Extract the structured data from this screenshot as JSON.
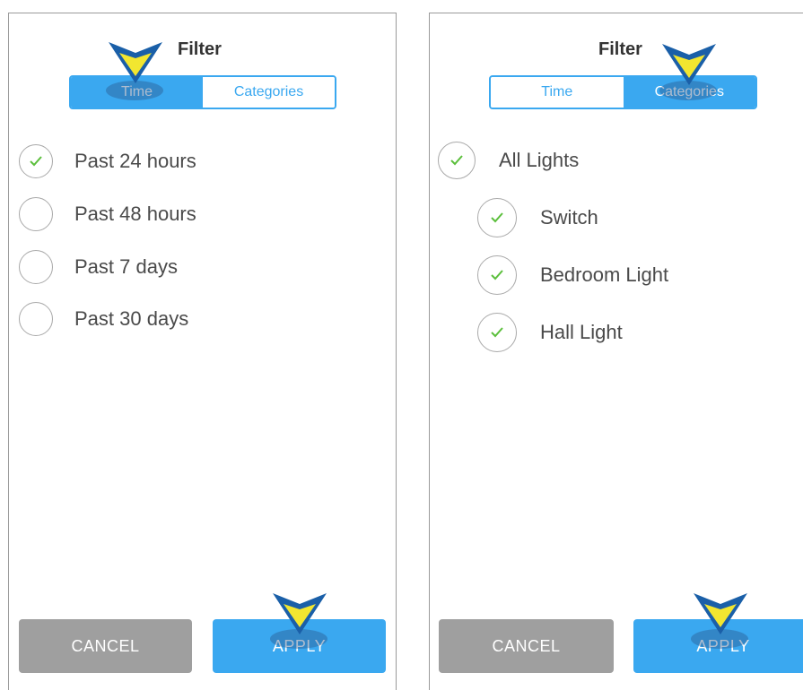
{
  "colors": {
    "accent": "#3aa8f0",
    "check": "#5bbf3c",
    "cancel": "#9f9f9f",
    "marker_fill": "#f2e630",
    "marker_edge": "#1a5fa8"
  },
  "left": {
    "title": "Filter",
    "tabs": [
      {
        "label": "Time",
        "active": true
      },
      {
        "label": "Categories",
        "active": false
      }
    ],
    "options": [
      {
        "label": "Past 24 hours",
        "checked": true
      },
      {
        "label": "Past 48 hours",
        "checked": false
      },
      {
        "label": "Past 7 days",
        "checked": false
      },
      {
        "label": "Past 30 days",
        "checked": false
      }
    ],
    "cancel_label": "CANCEL",
    "apply_label": "APPLY"
  },
  "right": {
    "title": "Filter",
    "tabs": [
      {
        "label": "Time",
        "active": false
      },
      {
        "label": "Categories",
        "active": true
      }
    ],
    "group": {
      "label": "All Lights",
      "checked": true
    },
    "items": [
      {
        "label": "Switch",
        "checked": true
      },
      {
        "label": "Bedroom Light",
        "checked": true
      },
      {
        "label": "Hall Light",
        "checked": true
      }
    ],
    "cancel_label": "CANCEL",
    "apply_label": "APPLY"
  },
  "icons": {
    "check": "checkmark-icon",
    "marker": "pointer-marker-icon"
  }
}
